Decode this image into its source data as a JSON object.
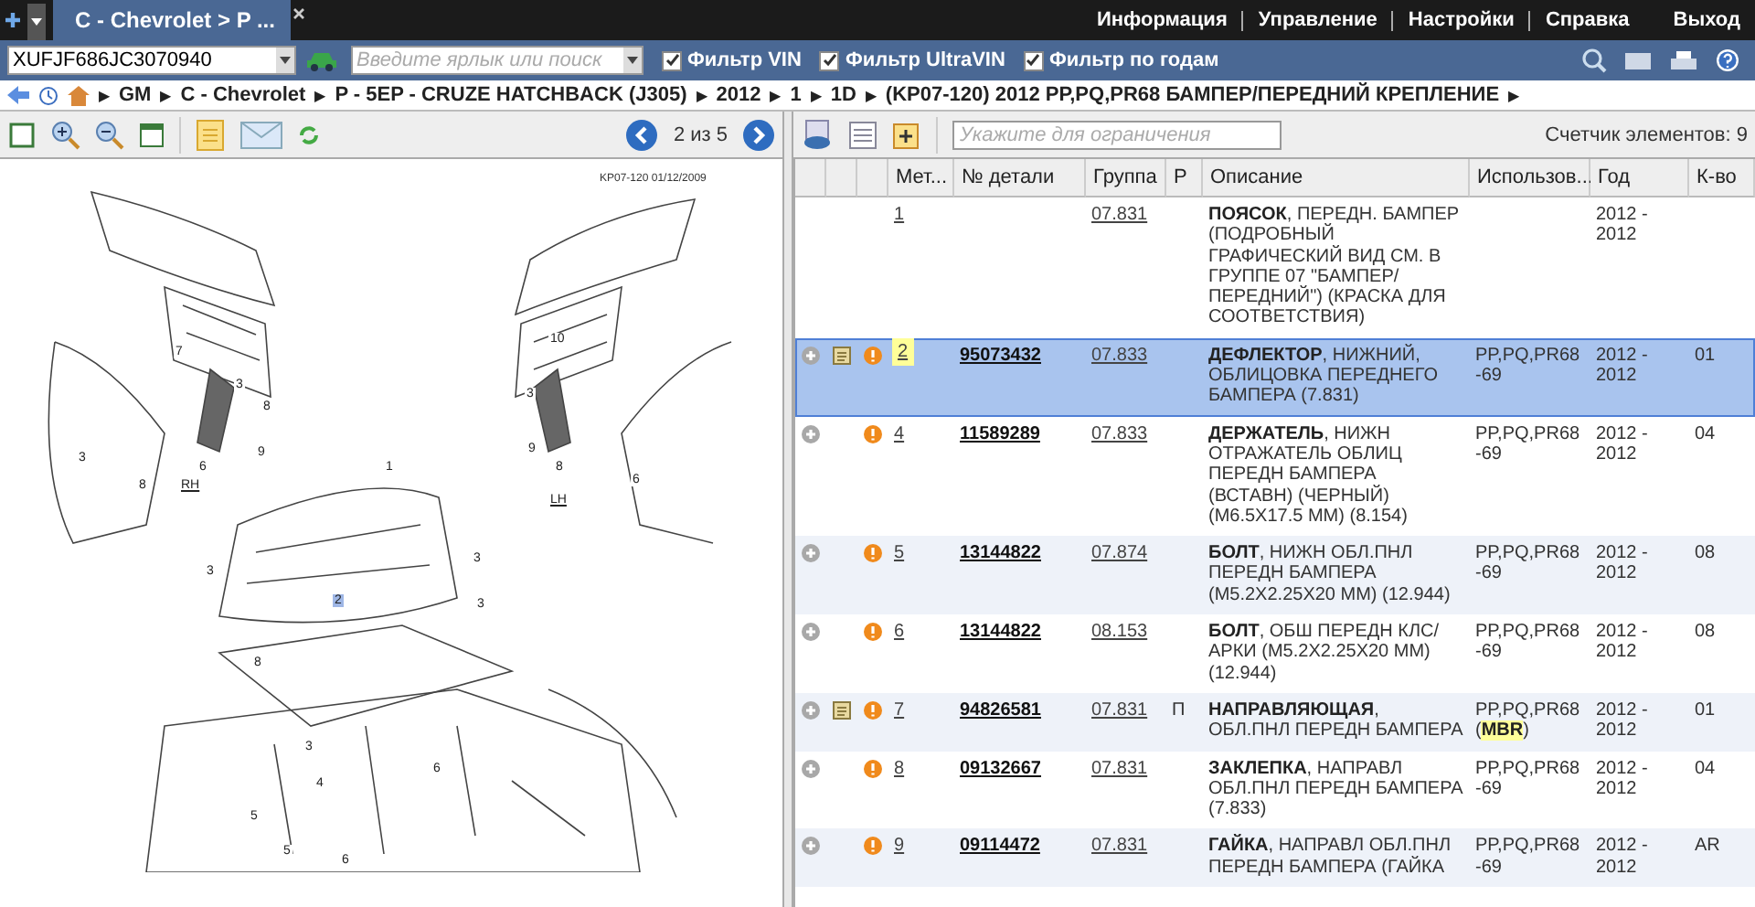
{
  "tabs": [
    {
      "label": "C - Chevrolet > P ...",
      "selected": true
    }
  ],
  "top_menu": [
    "Информация",
    "Управление",
    "Настройки",
    "Справка",
    "Выход"
  ],
  "vin_field": {
    "value": "XUFJF686JC3070940"
  },
  "search_field": {
    "placeholder": "Введите ярлык или поиск"
  },
  "filters": [
    {
      "label": "Фильтр VIN",
      "checked": true
    },
    {
      "label": "Фильтр UltraVIN",
      "checked": true
    },
    {
      "label": "Фильтр по годам",
      "checked": true
    }
  ],
  "breadcrumb": [
    {
      "arrow": "▶",
      "label": "GM"
    },
    {
      "arrow": "▶",
      "label": "C - Chevrolet"
    },
    {
      "arrow": "▶",
      "label": "P - 5EP - CRUZE HATCHBACK (J305)"
    },
    {
      "arrow": "▶",
      "label": "2012"
    },
    {
      "arrow": "▶",
      "label": "1"
    },
    {
      "arrow": "▶",
      "label": "1D"
    },
    {
      "arrow": "▶",
      "label": "(KP07-120)  2012  PP,PQ,PR68  БАМПЕР/ПЕРЕДНИЙ КРЕПЛЕНИЕ"
    }
  ],
  "breadcrumb_end": "▶",
  "viewer": {
    "page": "2 из 5",
    "stamp": "KP07-120 01/12/2009",
    "side_labels": [
      "RH",
      "LH"
    ],
    "callouts": [
      {
        "label": "7",
        "selected": false
      },
      {
        "label": "3",
        "selected": false
      },
      {
        "label": "8",
        "selected": false
      },
      {
        "label": "9",
        "selected": false
      },
      {
        "label": "6",
        "selected": false
      },
      {
        "label": "8",
        "selected": false
      },
      {
        "label": "3",
        "selected": false
      },
      {
        "label": "10",
        "selected": false
      },
      {
        "label": "3",
        "selected": false
      },
      {
        "label": "9",
        "selected": false
      },
      {
        "label": "8",
        "selected": false
      },
      {
        "label": "6",
        "selected": false
      },
      {
        "label": "1",
        "selected": false
      },
      {
        "label": "3",
        "selected": false
      },
      {
        "label": "3",
        "selected": false
      },
      {
        "label": "3",
        "selected": false
      },
      {
        "label": "2",
        "selected": true
      },
      {
        "label": "8",
        "selected": false
      },
      {
        "label": "3",
        "selected": false
      },
      {
        "label": "4",
        "selected": false
      },
      {
        "label": "5",
        "selected": false
      },
      {
        "label": "6",
        "selected": false
      },
      {
        "label": "5",
        "selected": false
      },
      {
        "label": "6",
        "selected": false
      }
    ]
  },
  "parts": {
    "filter": {
      "placeholder": "Укажите для ограничения"
    },
    "counter": "Счетчик элементов:  9",
    "columns": [
      "Мет...",
      "№ детали",
      "Группа",
      "P",
      "Описание",
      "Использов...",
      "Год",
      "К-во"
    ],
    "rows": [
      {
        "ref": "1",
        "part": "",
        "group": "07.831",
        "p": "",
        "desc": "**ПОЯСОК**,  ПЕРЕДН. БАМПЕР (ПОДРОБНЫЙ ГРАФИЧЕСКИЙ ВИД СМ. В ГРУППЕ 07 \"БАМПЕР/ ПЕРЕДНИЙ\") (КРАСКА ДЛЯ СООТВЕТСТВИЯ)",
        "usage": "",
        "year": "2012 - 2012",
        "qty": "",
        "expandable": false,
        "note": false,
        "warning": false,
        "selected": false
      },
      {
        "ref": "2",
        "part": "95073432",
        "group": "07.833",
        "p": "",
        "desc": "**ДЕФЛЕКТОР**,  НИЖНИЙ, ОБЛИЦОВКА ПЕРЕДНЕГО БАМПЕРА (7.831)",
        "usage": "PP,PQ,PR68 -69",
        "year": "2012 - 2012",
        "qty": "01",
        "expandable": true,
        "note": true,
        "warning": true,
        "selected": true
      },
      {
        "ref": "4",
        "part": "11589289",
        "group": "07.833",
        "p": "",
        "desc": "**ДЕРЖАТЕЛЬ**,  НИЖН ОТРАЖАТЕЛЬ ОБЛИЦ ПЕРЕДН БАМПЕРА (ВСТАВН) (ЧЕРНЫЙ) (M6.5X17.5 MM) (8.154)",
        "usage": "PP,PQ,PR68 -69",
        "year": "2012 - 2012",
        "qty": "04",
        "expandable": true,
        "note": false,
        "warning": true,
        "selected": false
      },
      {
        "ref": "5",
        "part": "13144822",
        "group": "07.874",
        "p": "",
        "desc": "**БОЛТ**, НИЖН ОБЛ.ПНЛ ПЕРЕДН БАМПЕРА (M5.2X2.25X20 MM) (12.944)",
        "usage": "PP,PQ,PR68 -69",
        "year": "2012 - 2012",
        "qty": "08",
        "expandable": true,
        "note": false,
        "warning": true,
        "selected": false
      },
      {
        "ref": "6",
        "part": "13144822",
        "group": "08.153",
        "p": "",
        "desc": "**БОЛТ**, ОБШ ПЕРЕДН КЛС/ АРКИ (M5.2X2.25X20 MM) (12.944)",
        "usage": "PP,PQ,PR68 -69",
        "year": "2012 - 2012",
        "qty": "08",
        "expandable": true,
        "note": false,
        "warning": true,
        "selected": false
      },
      {
        "ref": "7",
        "part": "94826581",
        "group": "07.831",
        "p": "П",
        "desc": "**НАПРАВЛЯЮЩАЯ**, ОБЛ.ПНЛ ПЕРЕДН БАМПЕРА",
        "usage": "PP,PQ,PR68 (**MBR**)",
        "year": "2012 - 2012",
        "qty": "01",
        "expandable": true,
        "note": true,
        "warning": true,
        "selected": false
      },
      {
        "ref": "8",
        "part": "09132667",
        "group": "07.831",
        "p": "",
        "desc": "**ЗАКЛЕПКА**, НАПРАВЛ ОБЛ.ПНЛ ПЕРЕДН БАМПЕРА (7.833)",
        "usage": "PP,PQ,PR68 -69",
        "year": "2012 - 2012",
        "qty": "04",
        "expandable": true,
        "note": false,
        "warning": true,
        "selected": false
      },
      {
        "ref": "9",
        "part": "09114472",
        "group": "07.831",
        "p": "",
        "desc": "**ГАЙКА**, НАПРАВЛ ОБЛ.ПНЛ ПЕРЕДН БАМПЕРА (ГАЙКА",
        "usage": "PP,PQ,PR68 -69",
        "year": "2012 - 2012",
        "qty": "AR",
        "expandable": true,
        "note": false,
        "warning": true,
        "selected": false
      }
    ]
  }
}
